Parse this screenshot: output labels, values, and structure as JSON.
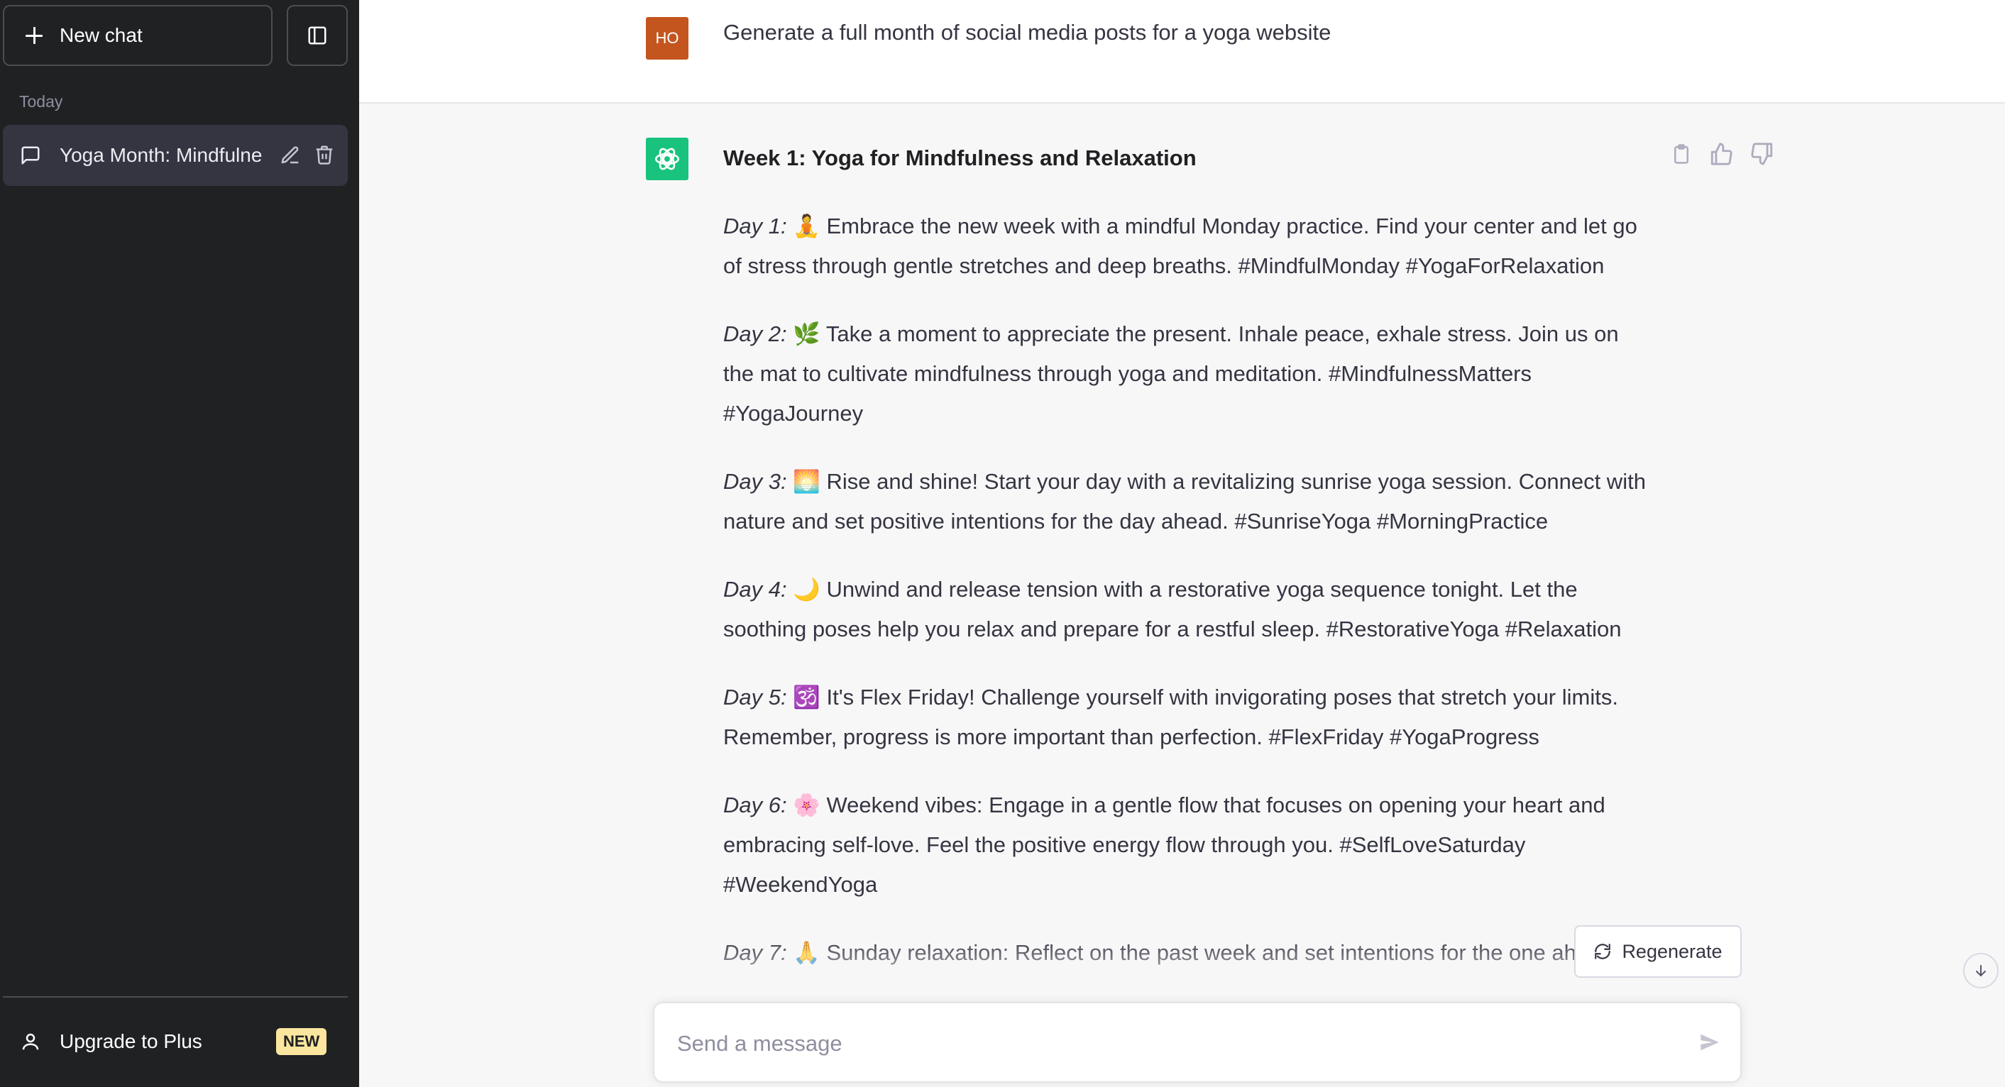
{
  "sidebar": {
    "new_chat_label": "New chat",
    "section_label": "Today",
    "conversations": [
      {
        "title": "Yoga Month: Mindfulne"
      }
    ],
    "upgrade_label": "Upgrade to Plus",
    "upgrade_badge": "NEW"
  },
  "conversation": {
    "user_initials": "HO",
    "user_message": "Generate a full month of social media posts for a yoga website",
    "response": {
      "heading": "Week 1: Yoga for Mindfulness and Relaxation",
      "posts": [
        {
          "day": "Day 1:",
          "emoji": "🧘",
          "text": "Embrace the new week with a mindful Monday practice. Find your center and let go of stress through gentle stretches and deep breaths. #MindfulMonday #YogaForRelaxation"
        },
        {
          "day": "Day 2:",
          "emoji": "🌿",
          "text": "Take a moment to appreciate the present. Inhale peace, exhale stress. Join us on the mat to cultivate mindfulness through yoga and meditation. #MindfulnessMatters #YogaJourney"
        },
        {
          "day": "Day 3:",
          "emoji": "🌅",
          "text": "Rise and shine! Start your day with a revitalizing sunrise yoga session. Connect with nature and set positive intentions for the day ahead. #SunriseYoga #MorningPractice"
        },
        {
          "day": "Day 4:",
          "emoji": "🌙",
          "text": "Unwind and release tension with a restorative yoga sequence tonight. Let the soothing poses help you relax and prepare for a restful sleep. #RestorativeYoga #Relaxation"
        },
        {
          "day": "Day 5:",
          "emoji": "🕉️",
          "text": "It's Flex Friday! Challenge yourself with invigorating poses that stretch your limits. Remember, progress is more important than perfection. #FlexFriday #YogaProgress"
        },
        {
          "day": "Day 6:",
          "emoji": "🌸",
          "text": "Weekend vibes: Engage in a gentle flow that focuses on opening your heart and embracing self-love. Feel the positive energy flow through you. #SelfLoveSaturday #WeekendYoga"
        },
        {
          "day": "Day 7:",
          "emoji": "🙏",
          "text": "Sunday relaxation: Reflect on the past week and set intentions for the one ahead."
        }
      ]
    }
  },
  "actions": {
    "regenerate_label": "Regenerate"
  },
  "composer": {
    "placeholder": "Send a message",
    "value": ""
  },
  "icons": {
    "new_chat": "plus-icon",
    "toggle_sidebar": "sidebar-toggle-icon",
    "conversation": "chat-bubble-icon",
    "edit": "pencil-icon",
    "delete": "trash-icon",
    "upgrade": "user-icon",
    "assistant": "openai-logo",
    "copy": "clipboard-icon",
    "like": "thumbs-up-icon",
    "dislike": "thumbs-down-icon",
    "regenerate": "refresh-icon",
    "scroll": "arrow-down-icon",
    "send": "send-icon"
  },
  "colors": {
    "sidebar_bg": "#202123",
    "active_item_bg": "#343541",
    "user_avatar": "#c4551f",
    "assistant_avatar": "#19c37d",
    "badge_bg": "#fae69e",
    "main_bg": "#f7f7f8"
  }
}
